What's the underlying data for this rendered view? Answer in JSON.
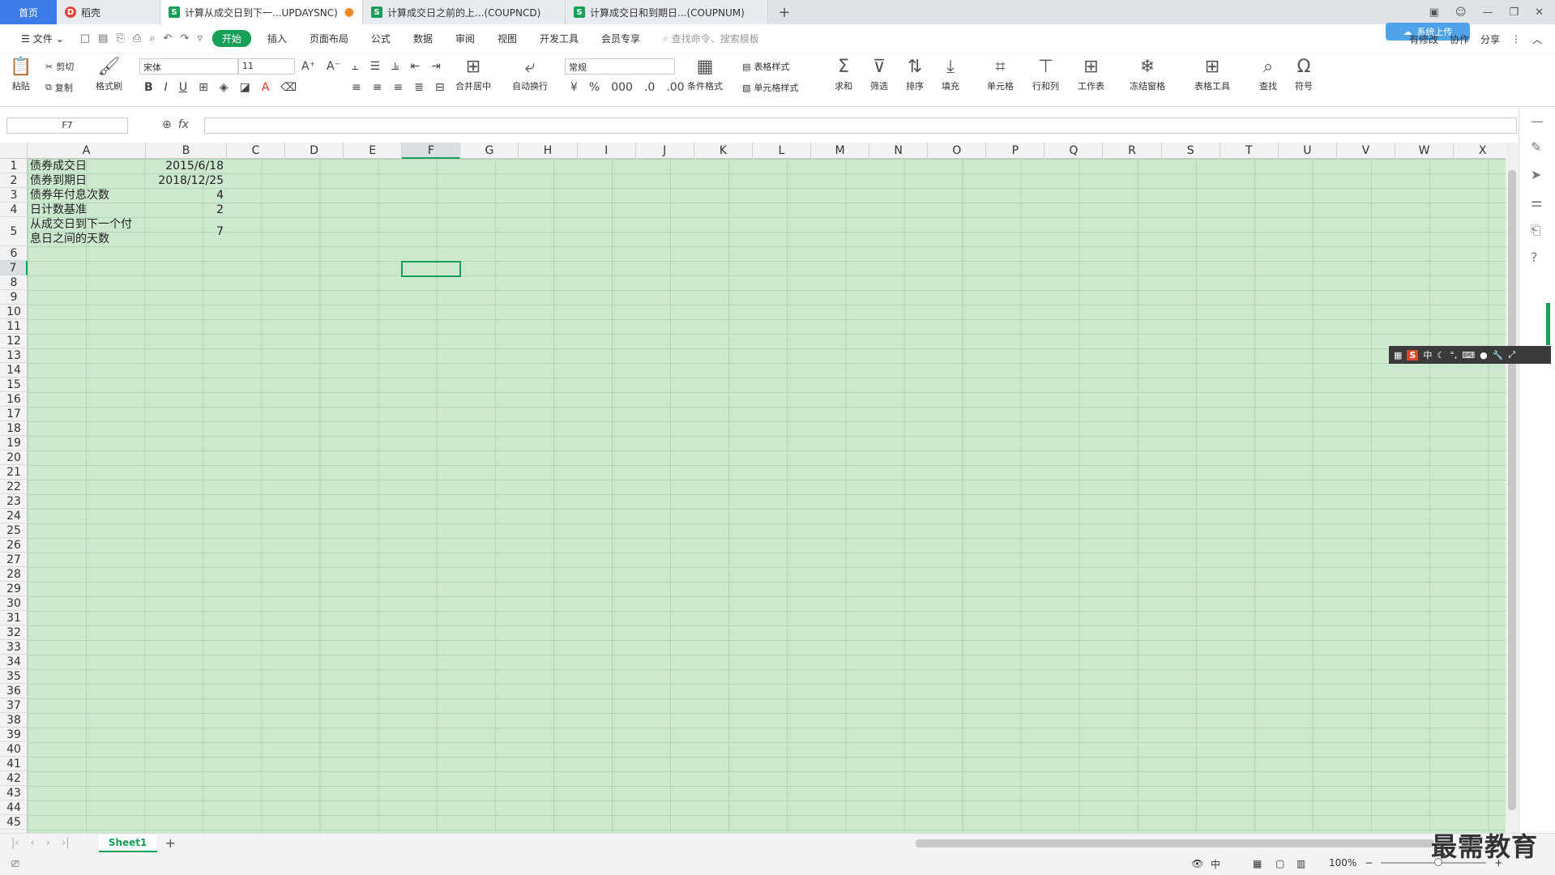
{
  "tabs": {
    "home": "首页",
    "docer": "稻壳",
    "files": [
      {
        "label": "计算从成交日到下一...UPDAYSNC)",
        "active": true,
        "modified": "●"
      },
      {
        "label": "计算成交日之前的上...(COUPNCD)",
        "active": false
      },
      {
        "label": "计算成交日和到期日...(COUPNUM)",
        "active": false
      }
    ],
    "add": "+"
  },
  "menu": {
    "file": "文件",
    "items": [
      "开始",
      "插入",
      "页面布局",
      "公式",
      "数据",
      "审阅",
      "视图",
      "开发工具",
      "会员专享"
    ],
    "active": "开始",
    "search_placeholder": "查找命令、搜索模板",
    "right": {
      "unsaved": "有修改",
      "collab": "协作",
      "share": "分享"
    },
    "cloud_badge": "系统上传"
  },
  "ribbon": {
    "paste": "粘贴",
    "cut": "剪切",
    "copy": "复制",
    "format_painter": "格式刷",
    "font_name": "宋体",
    "font_size": "11",
    "merge_center": "合并居中",
    "wrap_text": "自动换行",
    "number_format": "常规",
    "conditional_format": "条件格式",
    "table_style": "表格样式",
    "cell_style": "单元格样式",
    "sum": "求和",
    "filter": "筛选",
    "sort": "排序",
    "fill": "填充",
    "cells": "单元格",
    "row_col": "行和列",
    "worksheet": "工作表",
    "freeze": "冻结窗格",
    "table_tools": "表格工具",
    "find": "查找",
    "symbol": "符号"
  },
  "formula_bar": {
    "name_box": "F7",
    "fx": "fx",
    "content": ""
  },
  "columns": [
    "A",
    "B",
    "C",
    "D",
    "E",
    "F",
    "G",
    "H",
    "I",
    "J",
    "K",
    "L",
    "M",
    "N",
    "O",
    "P",
    "Q",
    "R",
    "S",
    "T",
    "U",
    "V",
    "W",
    "X"
  ],
  "selected_column": "F",
  "selected_row": "7",
  "rows": [
    "1",
    "2",
    "3",
    "4",
    "5",
    "6",
    "7",
    "8",
    "9",
    "10",
    "11",
    "12",
    "13",
    "14",
    "15",
    "16",
    "17",
    "18",
    "19",
    "20",
    "21",
    "22",
    "23",
    "24",
    "25",
    "26",
    "27",
    "28",
    "29",
    "30",
    "31",
    "32",
    "33",
    "34",
    "35",
    "36",
    "37",
    "38",
    "39",
    "40",
    "41",
    "42",
    "43",
    "44",
    "45"
  ],
  "cells": {
    "A1": "债券成交日",
    "B1": "2015/6/18",
    "A2": "债券到期日",
    "B2": "2018/12/25",
    "A3": "债券年付息次数",
    "B3": "4",
    "A4": "日计数基准",
    "B4": "2",
    "A5_line1": "从成交日到下一个付",
    "A5_line2": "息日之间的天数",
    "B5": "7"
  },
  "sheets": {
    "tabs": [
      "Sheet1"
    ],
    "add": "+"
  },
  "status": {
    "zoom": "100%",
    "ime_lang": "中"
  },
  "ime_bar": {
    "logo": "S",
    "lang": "中"
  },
  "watermark": "最需教育"
}
